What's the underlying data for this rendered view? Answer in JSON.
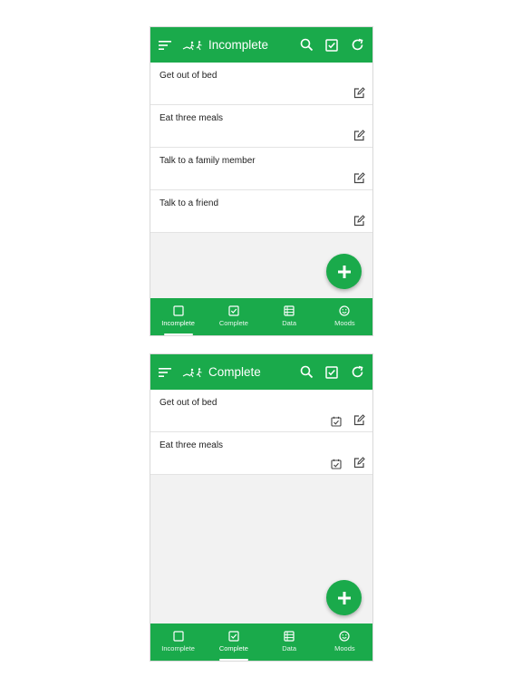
{
  "screens": [
    {
      "title": "Incomplete",
      "tasks": [
        "Get out of bed",
        "Eat three meals",
        "Talk to a family member",
        "Talk to a friend"
      ],
      "active_tab": 0
    },
    {
      "title": "Complete",
      "tasks": [
        "Get out of bed",
        "Eat three meals"
      ],
      "active_tab": 1
    }
  ],
  "nav": {
    "items": [
      {
        "label": "Incomplete",
        "icon": "square-icon"
      },
      {
        "label": "Complete",
        "icon": "checkbox-icon"
      },
      {
        "label": "Data",
        "icon": "table-icon"
      },
      {
        "label": "Moods",
        "icon": "smiley-icon"
      }
    ]
  },
  "colors": {
    "accent": "#1aaa4b",
    "background": "#f2f2f2",
    "row_text": "#222222"
  },
  "icons": {
    "menu": "menu-icon",
    "logo": "running-figures-logo-icon",
    "search": "search-icon",
    "check": "check-square-icon",
    "refresh": "refresh-icon",
    "edit": "edit-icon",
    "calendar": "calendar-check-icon",
    "add": "plus-icon"
  }
}
